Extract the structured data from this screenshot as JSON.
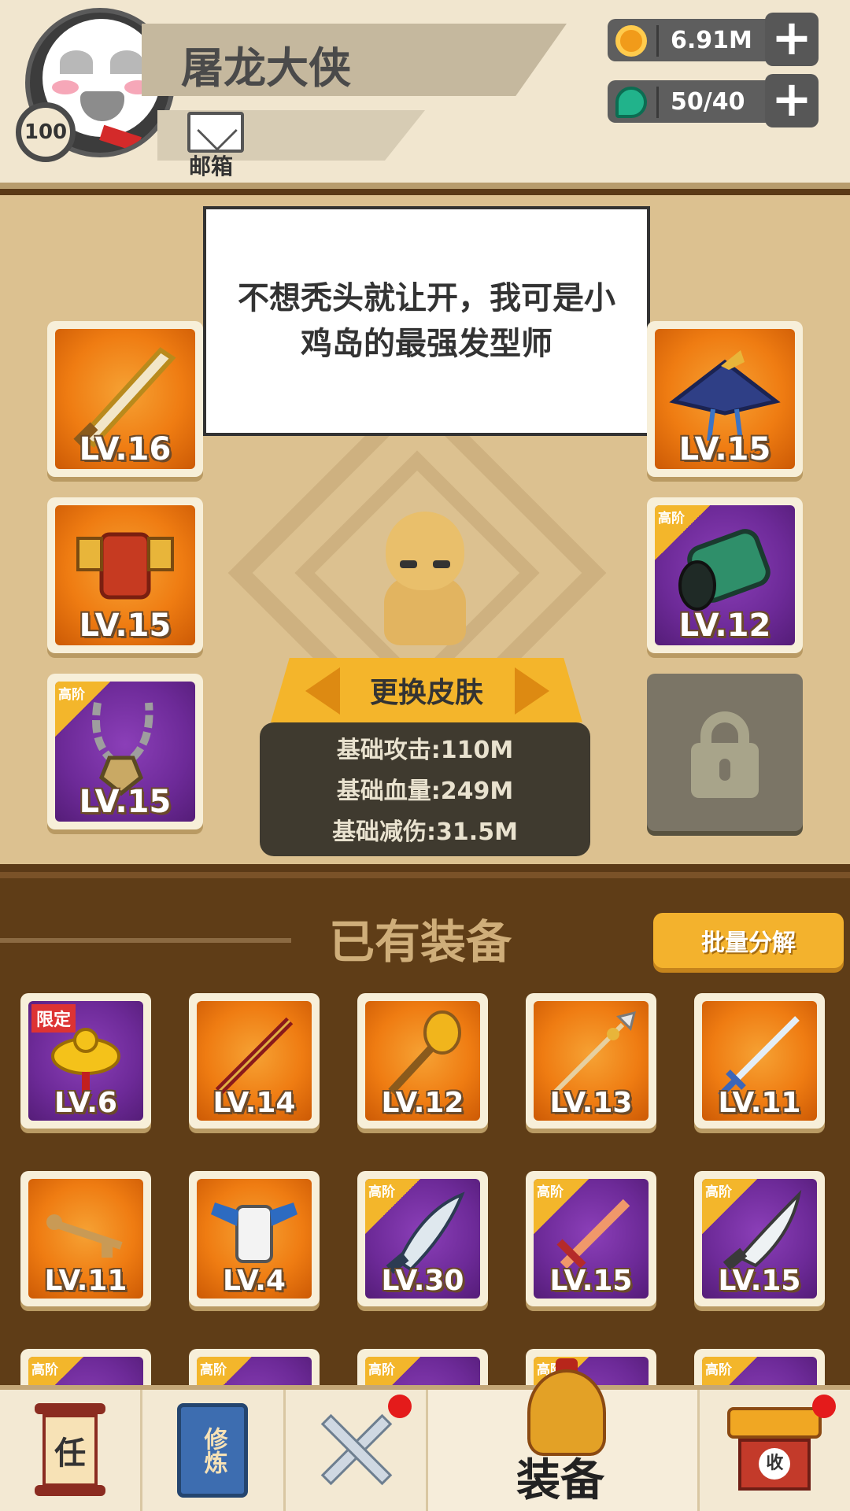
{
  "header": {
    "player_name": "屠龙大侠",
    "level": "100",
    "mail_label": "邮箱",
    "coins": "6.91M",
    "gems": "50/40"
  },
  "stage": {
    "speech": "不想秃头就让开，我可是小鸡岛的最强发型师",
    "skin_button": "更换皮肤",
    "stats": {
      "attack": "基础攻击:110M",
      "hp": "基础血量:249M",
      "damage_reduction": "基础减伤:31.5M"
    },
    "slots": [
      {
        "level": "LV.16",
        "rarity": "orange",
        "icon": "golden-sword-icon"
      },
      {
        "level": "LV.15",
        "rarity": "orange",
        "icon": "red-armor-icon"
      },
      {
        "level": "LV.15",
        "rarity": "purple",
        "tag": "高阶",
        "icon": "necklace-icon"
      },
      {
        "level": "LV.15",
        "rarity": "orange",
        "icon": "hat-icon"
      },
      {
        "level": "LV.12",
        "rarity": "purple",
        "tag": "高阶",
        "icon": "bracer-icon"
      }
    ]
  },
  "owned": {
    "title": "已有装备",
    "bulk_button": "批量分解",
    "row1": [
      {
        "level": "LV.6",
        "rarity": "purple",
        "tag_red": "限定",
        "icon": "gold-ornament-icon"
      },
      {
        "level": "LV.14",
        "rarity": "orange",
        "icon": "staff-icon"
      },
      {
        "level": "LV.12",
        "rarity": "orange",
        "icon": "mace-icon"
      },
      {
        "level": "LV.13",
        "rarity": "orange",
        "icon": "spear-icon"
      },
      {
        "level": "LV.11",
        "rarity": "orange",
        "icon": "sword-icon"
      }
    ],
    "row2": [
      {
        "level": "LV.11",
        "rarity": "orange",
        "icon": "key-icon"
      },
      {
        "level": "LV.4",
        "rarity": "orange",
        "icon": "white-armor-icon"
      },
      {
        "level": "LV.30",
        "rarity": "purple",
        "tag": "高阶",
        "icon": "broadsword-icon"
      },
      {
        "level": "LV.15",
        "rarity": "purple",
        "tag": "高阶",
        "icon": "red-sword-icon"
      },
      {
        "level": "LV.15",
        "rarity": "purple",
        "tag": "高阶",
        "icon": "saber-icon"
      }
    ],
    "row3_tags": [
      "高阶",
      "高阶",
      "高阶",
      "高阶",
      "高阶"
    ]
  },
  "nav": {
    "task_glyph": "任",
    "cultivate_glyph": "修炼",
    "active_label": "装备",
    "shop_glyph": "收"
  }
}
